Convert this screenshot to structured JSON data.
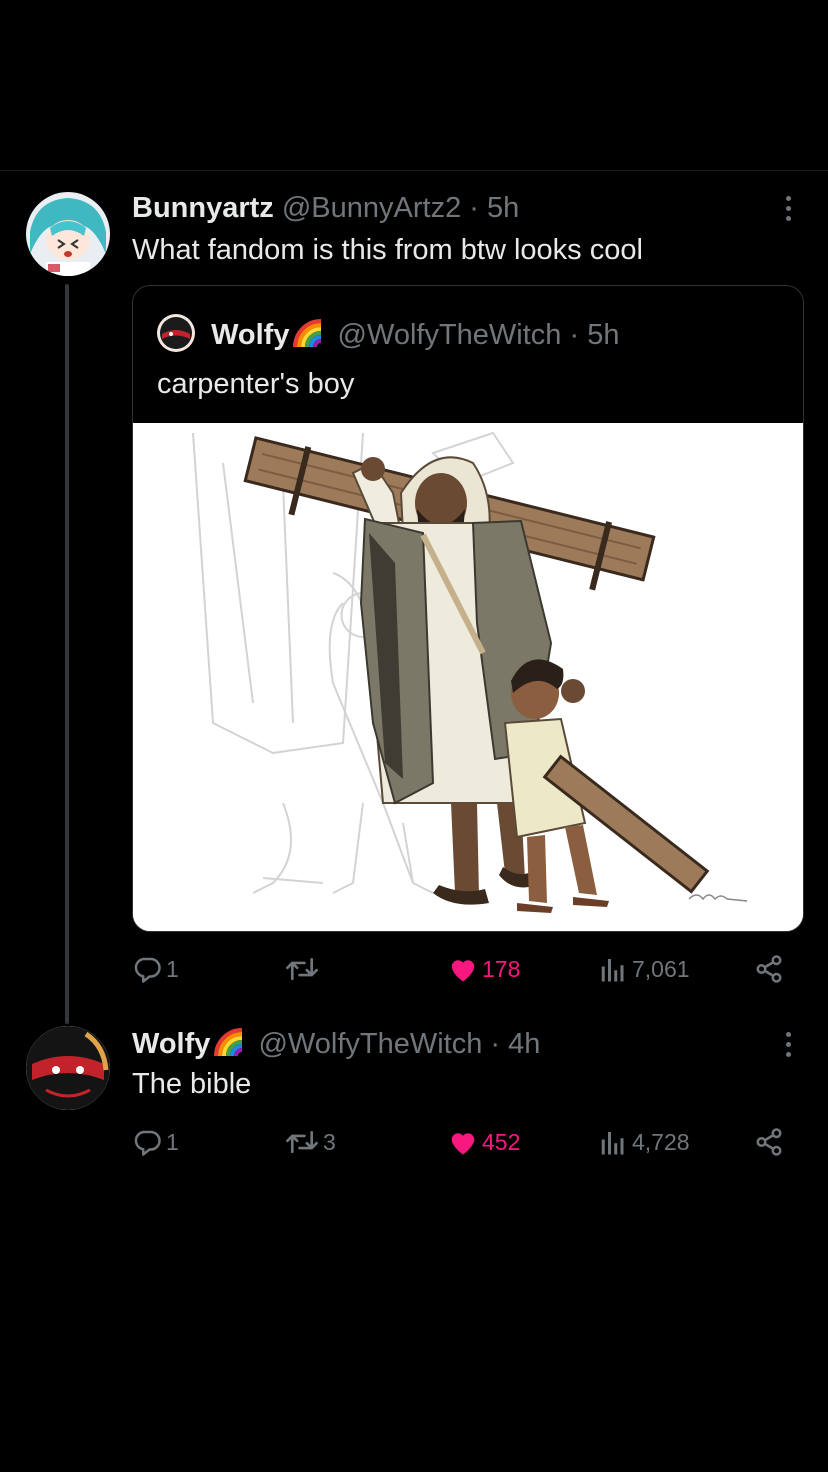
{
  "colors": {
    "background": "#000000",
    "text": "#e7e9ea",
    "muted": "#71767b",
    "like": "#f91880",
    "border": "#2f3336"
  },
  "reply1": {
    "name": "Bunnyartz",
    "handle": "@BunnyArtz2",
    "separator": "·",
    "time": "5h",
    "text": "What fandom is this from btw looks cool",
    "quote": {
      "name": "Wolfy",
      "handle": "@WolfyTheWitch",
      "separator": "·",
      "time": "5h",
      "text": "carpenter's boy"
    },
    "actions": {
      "replies": "1",
      "retweets": "",
      "likes": "178",
      "views": "7,061"
    },
    "icons": [
      "reply-icon",
      "retweet-icon",
      "heart-icon",
      "views-icon",
      "share-icon",
      "more-icon",
      "rainbow-emoji"
    ]
  },
  "reply2": {
    "name": "Wolfy",
    "handle": "@WolfyTheWitch",
    "separator": "·",
    "time": "4h",
    "text": "The bible",
    "actions": {
      "replies": "1",
      "retweets": "3",
      "likes": "452",
      "views": "4,728"
    }
  }
}
